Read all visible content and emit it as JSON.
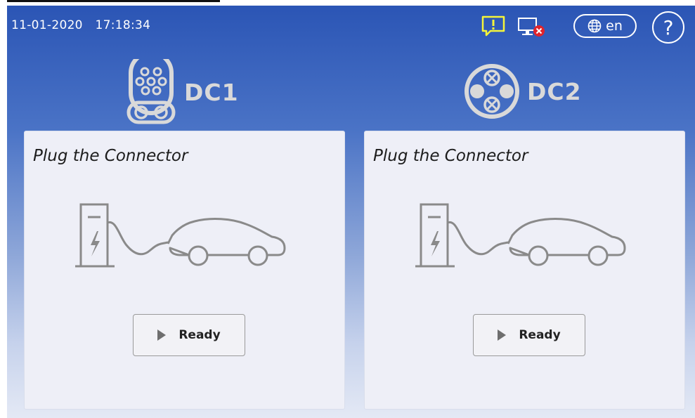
{
  "status_bar": {
    "date": "11-01-2020",
    "time": "17:18:34",
    "language": "en",
    "help_symbol": "?",
    "alert_icon": "alert-message-icon",
    "monitor_icon": "monitor-disconnected-icon",
    "language_icon": "globe-icon"
  },
  "connectors": [
    {
      "name": "DC1",
      "icon": "ccs-combo-plug-icon",
      "title": "Plug the Connector",
      "button_label": "Ready",
      "button_icon": "play-icon"
    },
    {
      "name": "DC2",
      "icon": "chademo-plug-icon",
      "title": "Plug the Connector",
      "button_label": "Ready",
      "button_icon": "play-icon"
    }
  ],
  "colors": {
    "header_blue": "#2b55b5",
    "alert_yellow": "#f5f53a",
    "error_red": "#e0232b",
    "connector_gray": "#d9d9d9",
    "panel_bg": "#eeeff7"
  }
}
